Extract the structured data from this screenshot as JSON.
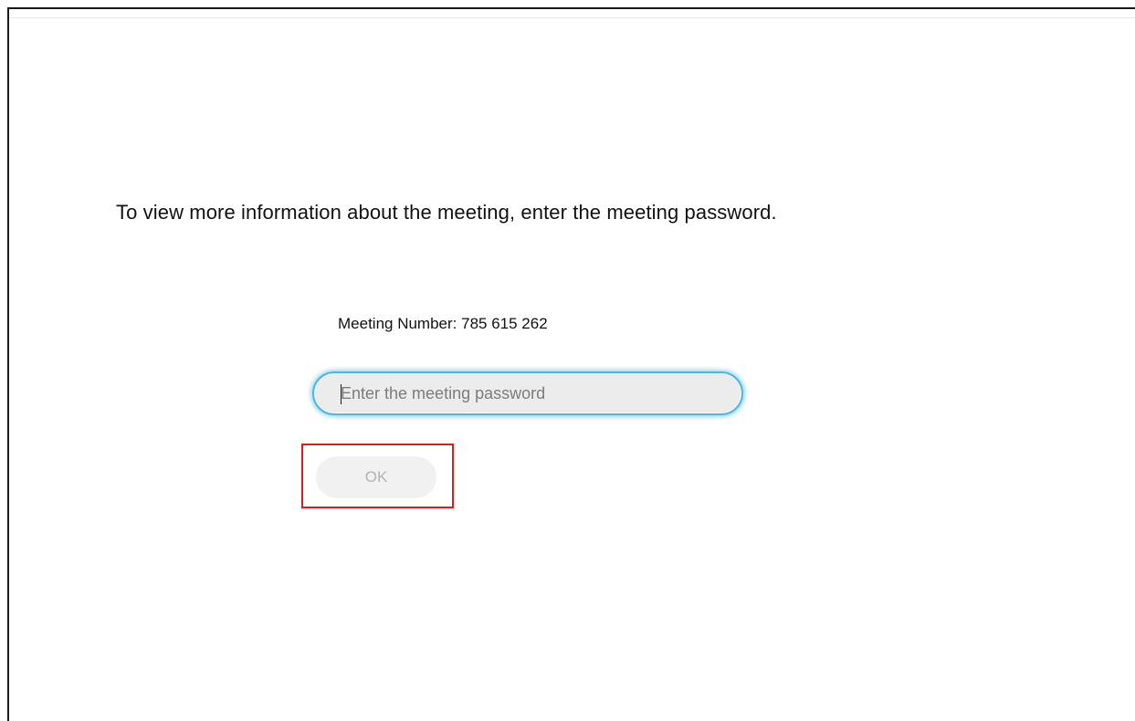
{
  "page": {
    "instruction": "To view more information about the meeting, enter the meeting password.",
    "meeting_number": "Meeting Number: 785 615 262",
    "password": {
      "value": "",
      "placeholder": "Enter the meeting password"
    },
    "ok_label": "OK",
    "ok_enabled": false
  },
  "colors": {
    "input_focus_border": "#4fb7e6",
    "input_background": "#ececec",
    "button_disabled_background": "#f1f1f1",
    "button_disabled_text": "#b3b3b3",
    "highlight_box": "#e21b1b"
  }
}
